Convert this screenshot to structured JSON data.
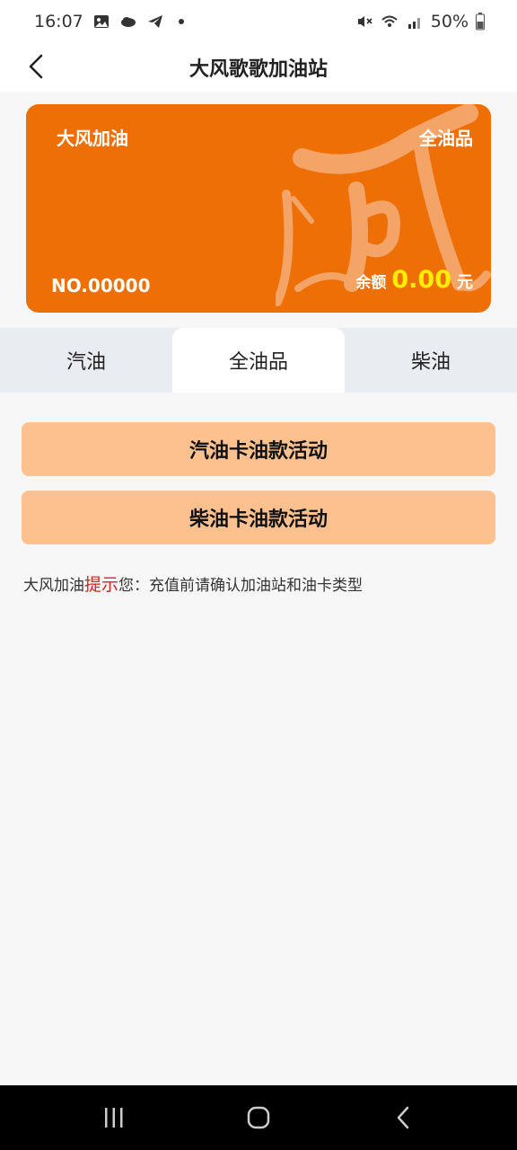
{
  "status_bar": {
    "time": "16:07",
    "battery": "50%",
    "icons": [
      "image-icon",
      "cloud-icon",
      "telegram-icon",
      "notification-dot-icon",
      "mute-icon",
      "wifi-icon",
      "signal-icon",
      "battery-icon"
    ]
  },
  "header": {
    "title": "大风歌歌加油站",
    "back_icon": "chevron-left-icon"
  },
  "card": {
    "brand": "大风加油",
    "type": "全油品",
    "number": "NO.00000",
    "balance_label": "余额",
    "balance_value": "0.00",
    "balance_unit": "元",
    "color": "#ee6f06",
    "balance_color": "#ffee00"
  },
  "tabs": [
    {
      "label": "汽油"
    },
    {
      "label": "全油品",
      "active": true
    },
    {
      "label": "柴油"
    }
  ],
  "buttons": {
    "gas_activity": "汽油卡油款活动",
    "diesel_activity": "柴油卡油款活动",
    "color": "#fdc18f"
  },
  "notice": {
    "prefix": "大风加油",
    "highlight": "提示",
    "suffix": "您：充值前请确认加油站和油卡类型",
    "highlight_color": "#d0241c"
  },
  "nav_bar": {
    "recent_icon": "recent-apps-icon",
    "home_icon": "home-icon",
    "back_icon": "back-icon"
  }
}
